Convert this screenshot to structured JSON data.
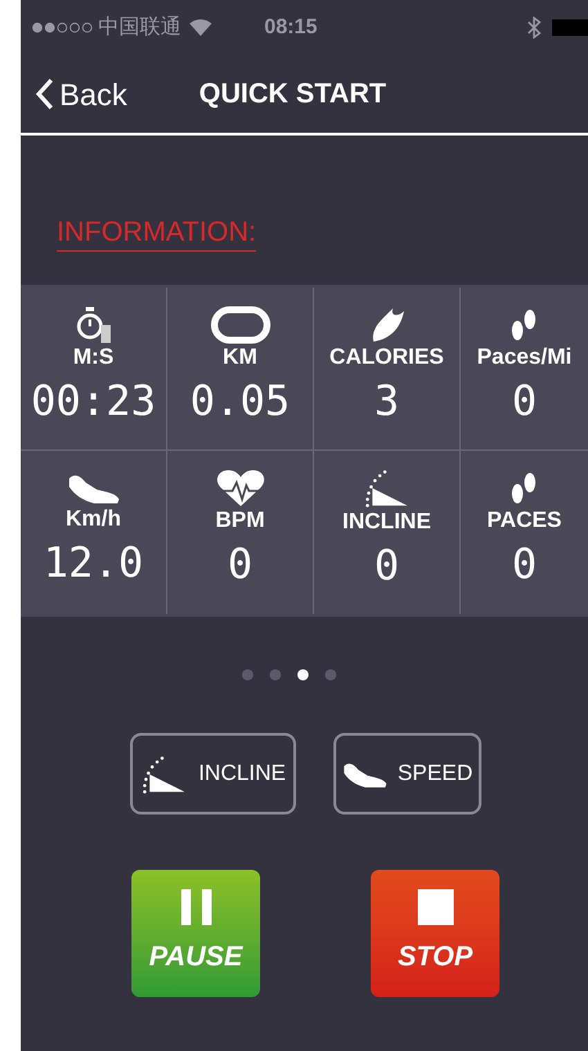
{
  "status_bar": {
    "carrier": "中国联通",
    "time": "08:15"
  },
  "nav": {
    "back": "Back",
    "title": "QUICK START"
  },
  "section_title": "INFORMATION:",
  "metrics": [
    {
      "kind": "time",
      "label": "M:S",
      "value": "00:23"
    },
    {
      "kind": "distance",
      "label": "KM",
      "value": "0.05"
    },
    {
      "kind": "calories",
      "label": "CALORIES",
      "value": "3"
    },
    {
      "kind": "cadence",
      "label": "Paces/Mi",
      "value": "0"
    },
    {
      "kind": "speed",
      "label": "Km/h",
      "value": "12.0"
    },
    {
      "kind": "heart_rate",
      "label": "BPM",
      "value": "0"
    },
    {
      "kind": "incline",
      "label": "INCLINE",
      "value": "0"
    },
    {
      "kind": "steps",
      "label": "PACES",
      "value": "0"
    }
  ],
  "pager": [
    {
      "selected": false
    },
    {
      "selected": false
    },
    {
      "selected": true
    },
    {
      "selected": false
    }
  ],
  "adjust_buttons": [
    {
      "kind": "incline",
      "label": "INCLINE"
    },
    {
      "kind": "speed",
      "label": "SPEED"
    }
  ],
  "control_buttons": [
    {
      "kind": "pause",
      "label": "PAUSE"
    },
    {
      "kind": "stop",
      "label": "STOP"
    }
  ]
}
